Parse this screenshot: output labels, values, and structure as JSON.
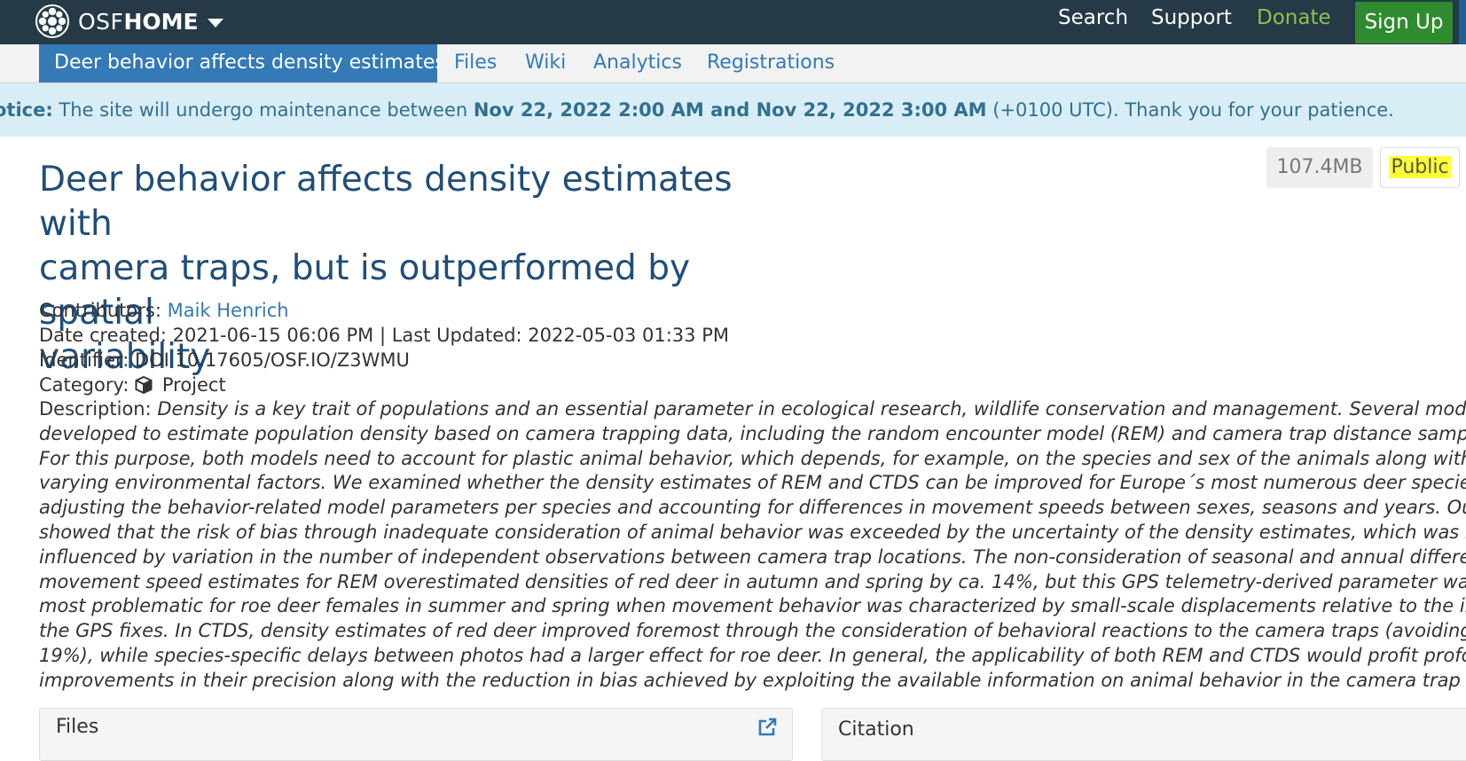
{
  "navbar": {
    "brand_osf": "OSF",
    "brand_home": "HOME",
    "links": {
      "search": "Search",
      "support": "Support",
      "donate": "Donate"
    },
    "signup": "Sign Up"
  },
  "project_nav": {
    "active": "Deer behavior affects density estimates...",
    "tabs": [
      "Files",
      "Wiki",
      "Analytics",
      "Registrations"
    ]
  },
  "notice": {
    "label": "otice:",
    "text_before": " The site will undergo maintenance between ",
    "bold_range": "Nov 22, 2022 2:00 AM and Nov 22, 2022 3:00 AM",
    "text_after": " (+0100 UTC). Thank you for your patience."
  },
  "badges": {
    "size": "107.4MB",
    "visibility": "Public"
  },
  "project": {
    "title_lines": [
      "Deer behavior affects density estimates with",
      "camera traps, but is outperformed by spatial",
      "variability"
    ],
    "contributors_label": "Contributors:",
    "contributor": "Maik Henrich",
    "dates": "Date created: 2021-06-15 06:06 PM | Last Updated: 2022-05-03 01:33 PM",
    "identifier": "Identifier: DOI 10.17605/OSF.IO/Z3WMU",
    "category_label": "Category:",
    "category": "Project",
    "description_label": "Description:",
    "description_lines": [
      "Density is a key trait of populations and an essential parameter in ecological research, wildlife conservation and management. Several models",
      "developed to estimate population density based on camera trapping data, including the random encounter model (REM) and camera trap distance sampli",
      "For this purpose, both models need to account for plastic animal behavior, which depends, for example, on the species and sex of the animals along with",
      "varying environmental factors. We examined whether the density estimates of REM and CTDS can be improved for Europe´s most numerous deer species,",
      "adjusting the behavior-related model parameters per species and accounting for differences in movement speeds between sexes, seasons and years. Our",
      "showed that the risk of bias through inadequate consideration of animal behavior was exceeded by the uncertainty of the density estimates, which was m",
      "influenced by variation in the number of independent observations between camera trap locations. The non-consideration of seasonal and annual differe",
      "movement speed estimates for REM overestimated densities of red deer in autumn and spring by ca. 14%, but this GPS telemetry-derived parameter was",
      "most problematic for roe deer females in summer and spring when movement behavior was characterized by small-scale displacements relative to the int",
      "the GPS fixes. In CTDS, density estimates of red deer improved foremost through the consideration of behavioral reactions to the camera traps (avoiding b",
      "19%), while species-specific delays between photos had a larger effect for roe deer. In general, the applicability of both REM and CTDS would profit profou",
      "improvements in their precision along with the reduction in bias achieved by exploiting the available information on animal behavior in the camera trap d"
    ]
  },
  "panels": {
    "files": "Files",
    "citation": "Citation"
  }
}
